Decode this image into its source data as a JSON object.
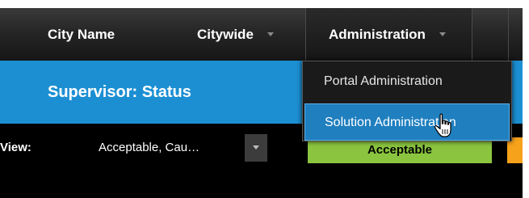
{
  "navbar": {
    "city_name": "City Name",
    "citywide": "Citywide",
    "administration": "Administration"
  },
  "admin_menu": {
    "items": [
      {
        "label": "Portal Administration"
      },
      {
        "label": "Solution Administration"
      }
    ]
  },
  "page": {
    "title": "Supervisor: Status"
  },
  "view_filter": {
    "label": "View:",
    "value": "Acceptable, Cau…"
  },
  "status_buttons": [
    {
      "label": "Acceptable",
      "color": "#8bc53f"
    },
    {
      "label": "",
      "color": "#f7a21b"
    }
  ],
  "colors": {
    "nav_bg": "#262626",
    "header_blue": "#1c8fd3",
    "menu_highlight": "#1f7fbf"
  },
  "icons": {
    "caret": "chevron-down-icon",
    "cursor": "hand-pointer-icon"
  }
}
